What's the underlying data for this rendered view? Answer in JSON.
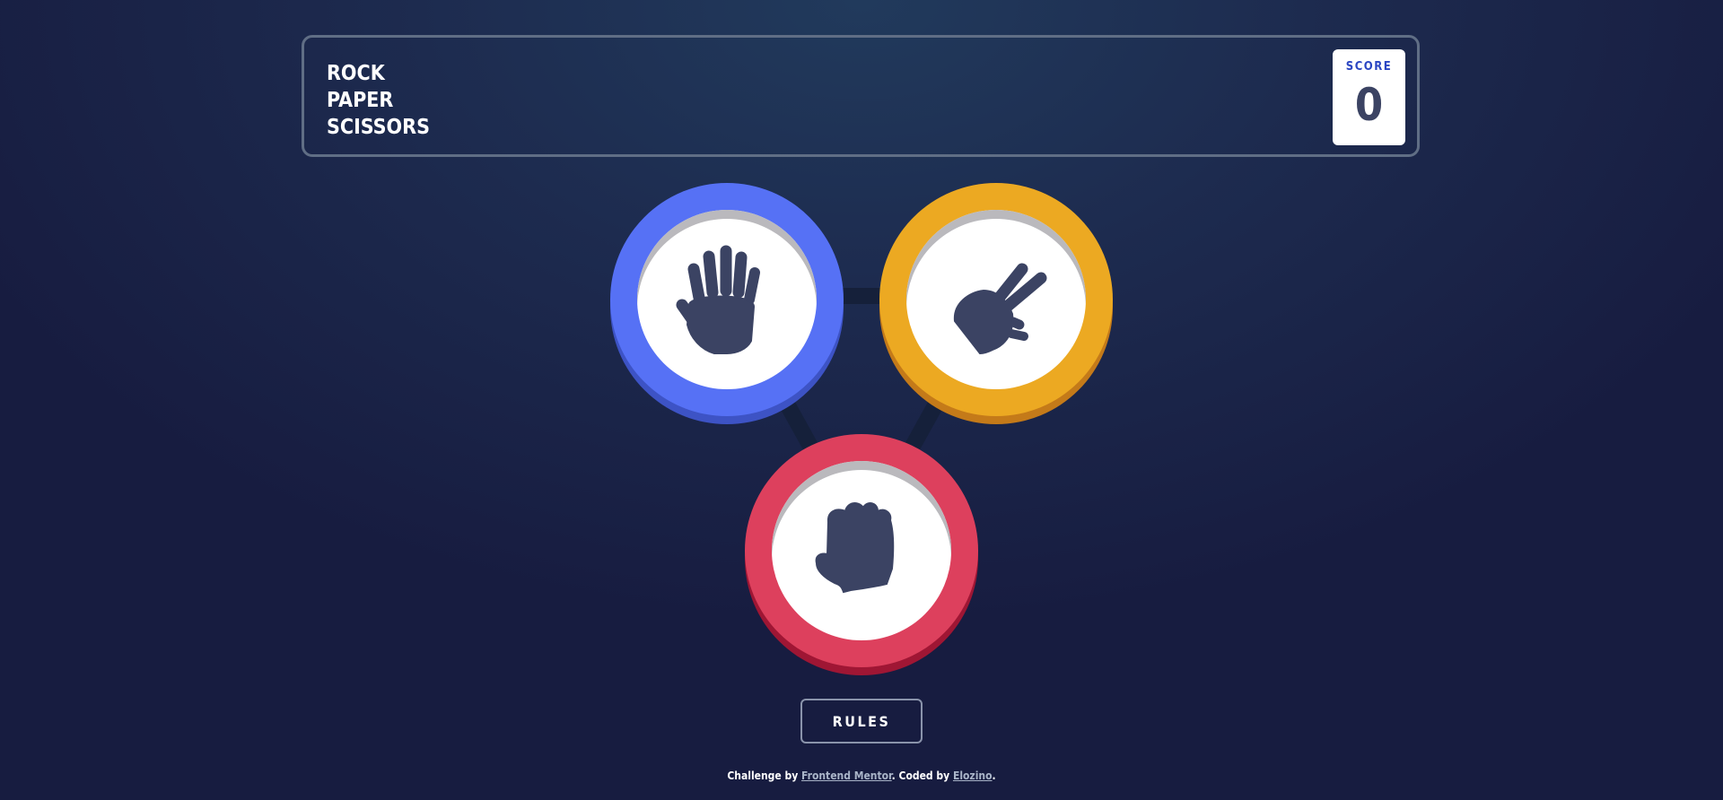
{
  "header": {
    "title_lines": [
      "ROCK",
      "PAPER",
      "SCISSORS"
    ],
    "score_label": "SCORE",
    "score_value": "0"
  },
  "tokens": [
    {
      "id": "paper",
      "icon": "paper-hand-icon",
      "color": "#5671f5"
    },
    {
      "id": "scissors",
      "icon": "scissors-hand-icon",
      "color": "#eca922"
    },
    {
      "id": "rock",
      "icon": "rock-fist-icon",
      "color": "#dd405d"
    }
  ],
  "rules_button": {
    "label": "RULES"
  },
  "attribution": {
    "prefix": "Challenge by",
    "mentor_link": "Frontend Mentor",
    "middle": ". Coded by",
    "author_link": "Elozino",
    "suffix": "."
  },
  "colors": {
    "background_dark": "#171c40",
    "background_light": "#213a5c",
    "header_outline": "#606e85",
    "score_text": "#2a45c2",
    "icon_dark": "#3b4363"
  }
}
